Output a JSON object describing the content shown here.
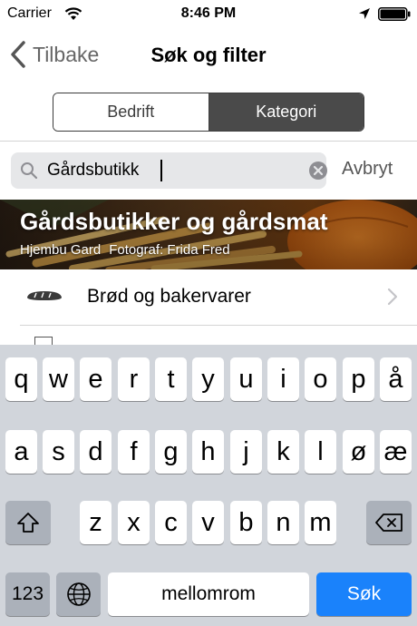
{
  "status_bar": {
    "carrier": "Carrier",
    "time": "8:46 PM"
  },
  "nav": {
    "back_label": "Tilbake",
    "title": "Søk og filter"
  },
  "segments": [
    {
      "label": "Bedrift",
      "selected": false
    },
    {
      "label": "Kategori",
      "selected": true
    }
  ],
  "search": {
    "value": "Gårdsbutikk",
    "cancel_label": "Avbryt"
  },
  "banner": {
    "title": "Gårdsbutikker og gårdsmat",
    "source": "Hjembu Gard",
    "photographer": "Fotograf: Frida Fred"
  },
  "list": {
    "items": [
      {
        "label": "Brød og bakervarer",
        "icon": "bread-icon"
      }
    ]
  },
  "keyboard": {
    "row1": [
      "q",
      "w",
      "e",
      "r",
      "t",
      "y",
      "u",
      "i",
      "o",
      "p",
      "å"
    ],
    "row2": [
      "a",
      "s",
      "d",
      "f",
      "g",
      "h",
      "j",
      "k",
      "l",
      "ø",
      "æ"
    ],
    "row3": [
      "z",
      "x",
      "c",
      "v",
      "b",
      "n",
      "m"
    ],
    "numbers_label": "123",
    "space_label": "mellomrom",
    "return_label": "Søk"
  },
  "colors": {
    "accent": "#1a82fb",
    "segment_selected": "#4a4a4a",
    "keyboard_bg": "#d1d5db"
  }
}
